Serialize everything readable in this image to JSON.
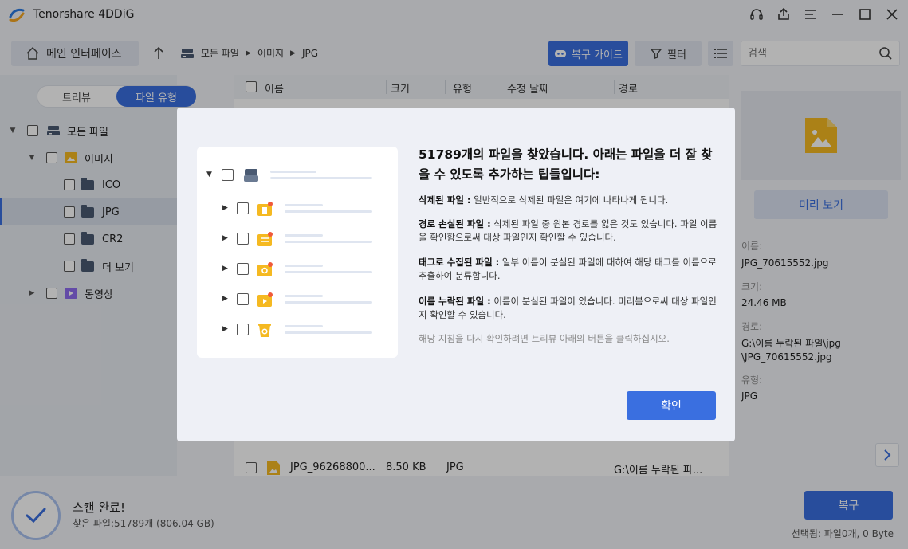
{
  "app": {
    "title": "Tenorshare 4DDiG"
  },
  "toolbar": {
    "home_label": "메인 인터페이스",
    "breadcrumb": [
      "모든 파일",
      "이미지",
      "JPG"
    ],
    "guide_label": "복구 가이드",
    "filter_label": "필터",
    "search_placeholder": "검색"
  },
  "sidebar": {
    "toggle": {
      "tree": "트리뷰",
      "file_type": "파일 유형"
    },
    "items": [
      {
        "label": "모든 파일"
      },
      {
        "label": "이미지"
      },
      {
        "label": "ICO"
      },
      {
        "label": "JPG"
      },
      {
        "label": "CR2"
      },
      {
        "label": "더 보기"
      },
      {
        "label": "동영상"
      }
    ]
  },
  "filelist": {
    "columns": [
      "이름",
      "크기",
      "유형",
      "수정 날짜",
      "경로"
    ],
    "rows": [
      {
        "name": "JPG_96268800...",
        "size": "8.50 KB",
        "type": "JPG",
        "date": "",
        "path": "G:\\이름 누락된 파..."
      }
    ]
  },
  "preview": {
    "button_label": "미리 보기",
    "name_label": "이름:",
    "name_value": "JPG_70615552.jpg",
    "size_label": "크기:",
    "size_value": "24.46 MB",
    "path_label": "경로:",
    "path_value_1": "G:\\이름 누락된 파일\\jpg",
    "path_value_2": "\\JPG_70615552.jpg",
    "type_label": "유형:",
    "type_value": "JPG"
  },
  "bottom": {
    "scan_title": "스캔 완료!",
    "scan_sub": "찾은 파일:51789개 (806.04 GB)",
    "recover_label": "복구",
    "selected_info": "선택됨: 파일0개, 0 Byte"
  },
  "modal": {
    "heading": "51789개의 파일을 찾았습니다. 아래는 파일을 더 잘 찾을 수 있도록 추가하는 팁들입니다:",
    "tips": [
      {
        "title": "삭제된 파일 :",
        "text": " 일반적으로 삭제된 파일은 여기에 나타나게 됩니다."
      },
      {
        "title": "경로 손실된 파일 :",
        "text": " 삭제된 파일 중 원본 경로를 잃은 것도 있습니다. 파일 이름을 확인함으로써 대상 파일인지 확인할 수 있습니다."
      },
      {
        "title": "태그로 수집된 파일 :",
        "text": " 일부 이름이 분실된 파일에 대하여 해당 태그를 이름으로 추출하여 분류합니다."
      },
      {
        "title": "이름 누락된 파일 :",
        "text": " 이름이 분실된 파일이 있습니다. 미리봄으로써 대상 파일인지 확인할 수 있습니다."
      }
    ],
    "hint": "해당 지침을 다시 확인하려면 트리뷰 아래의 버튼을 클릭하십시오.",
    "ok_label": "확인"
  },
  "colors": {
    "accent": "#3a6fe0",
    "folder_yellow": "#f5b921",
    "overlay": "rgba(0,0,0,0.30)"
  }
}
